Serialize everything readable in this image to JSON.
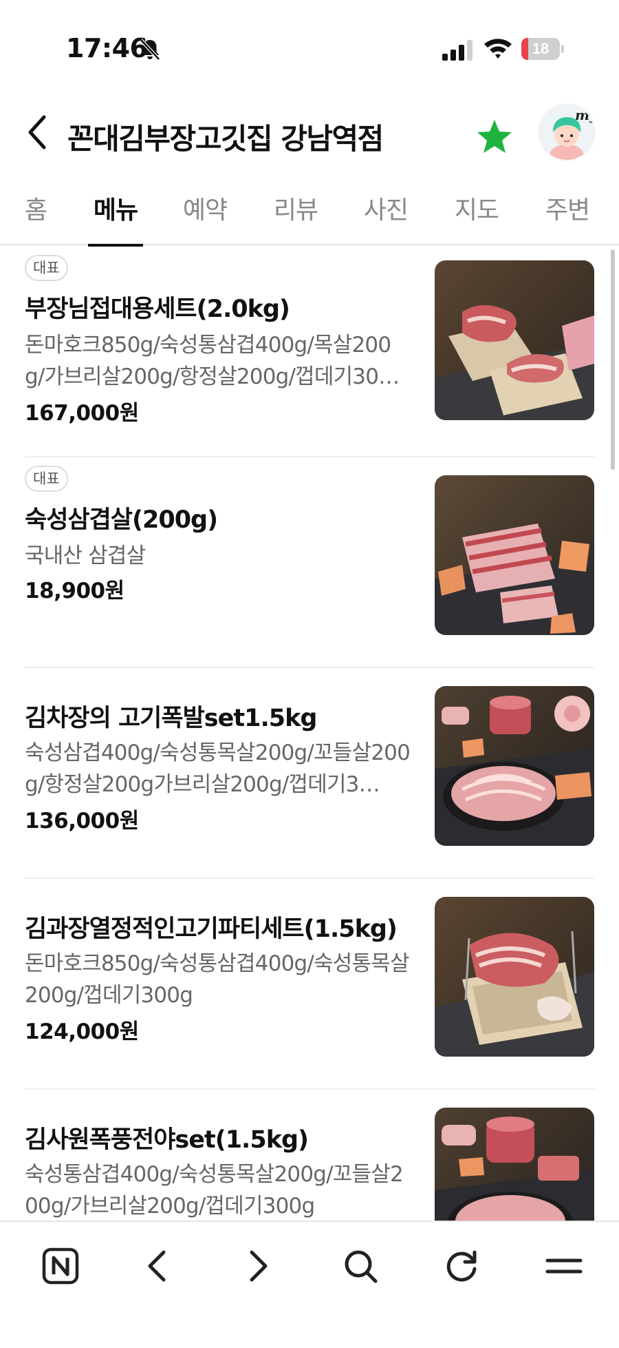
{
  "status": {
    "time": "17:46",
    "battery": "18",
    "battery_level": 0.18
  },
  "header": {
    "title": "꼰대김부장고깃집 강남역점",
    "avatar_label": "my"
  },
  "tabs": [
    {
      "label": "홈"
    },
    {
      "label": "메뉴"
    },
    {
      "label": "예약"
    },
    {
      "label": "리뷰"
    },
    {
      "label": "사진"
    },
    {
      "label": "지도"
    },
    {
      "label": "주변"
    }
  ],
  "active_tab": "메뉴",
  "menu": [
    {
      "badge": "대표",
      "name": "부장님접대용세트(2.0kg)",
      "desc": "돈마호크850g/숙성통삼겹400g/목살200g/가브리살200g/항정살200g/껍데기30…",
      "price": "167,000원",
      "image": "meat-set-box-photo"
    },
    {
      "badge": "대표",
      "name": "숙성삼겹살(200g)",
      "desc": "국내산 삼겹살",
      "price": "18,900원",
      "image": "pork-belly-photo"
    },
    {
      "badge": "",
      "name": "김차장의 고기폭발set1.5kg",
      "desc": "숙성삼겹400g/숙성통목살200g/꼬들살200g/항정살200g가브리살200g/껍데기3…",
      "price": "136,000원",
      "image": "meat-platter-photo"
    },
    {
      "badge": "",
      "name": "김과장열정적인고기파티세트(1.5kg)",
      "desc": "돈마호크850g/숙성통삼겹400g/숙성통목살200g/껍데기300g",
      "price": "124,000원",
      "image": "meat-set-box-photo"
    },
    {
      "badge": "",
      "name": "김사원폭풍전야set(1.5kg)",
      "desc": "숙성통삼겹400g/숙성통목살200g/꼬들살200g/가브리살200g/껍데기300g",
      "price": "",
      "image": "meat-platter-photo"
    }
  ],
  "bottom_nav": [
    "naver-home-icon",
    "back-arrow-icon",
    "forward-arrow-icon",
    "search-icon",
    "refresh-icon",
    "menu-icon"
  ],
  "colors": {
    "star": "#1fb33f",
    "battery_low": "#e8434b",
    "active_tab_bar": "#111111"
  }
}
